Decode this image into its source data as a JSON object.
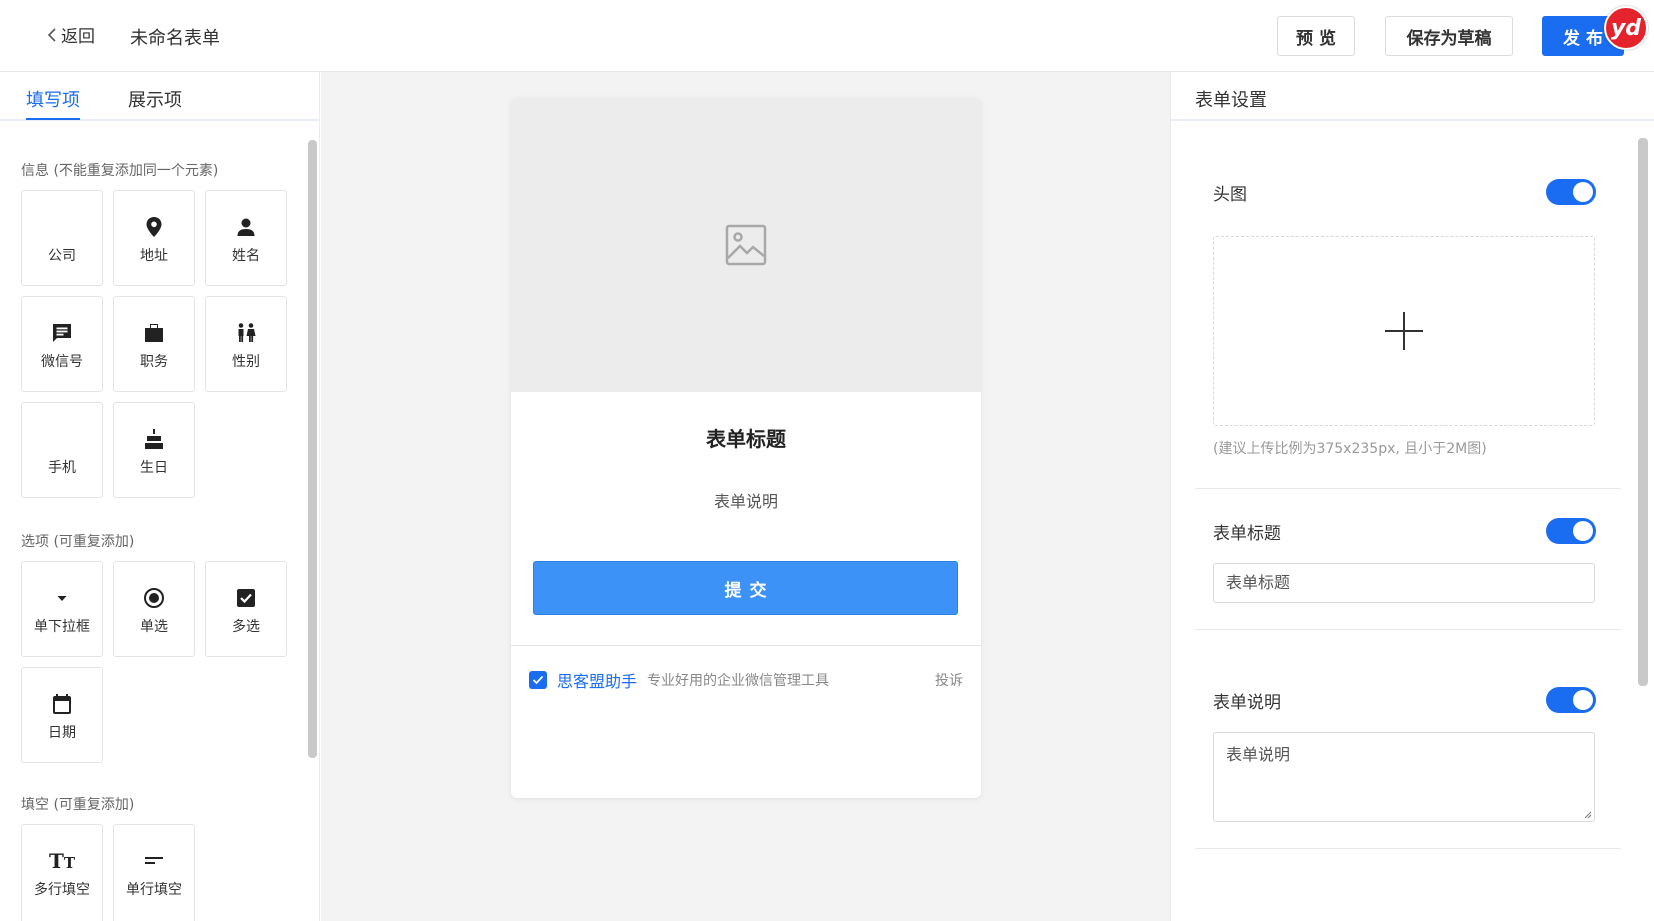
{
  "topbar": {
    "back_label": "返回",
    "form_name": "未命名表单",
    "preview_label": "预览",
    "draft_label": "保存为草稿",
    "publish_label": "发布",
    "badge_label": "yd"
  },
  "left": {
    "tabs": [
      {
        "label": "填写项",
        "active": true
      },
      {
        "label": "展示项",
        "active": false
      }
    ],
    "sections": [
      {
        "title": "信息 (不能重复添加同一个元素)",
        "items": [
          {
            "label": "公司",
            "icon": "company-icon"
          },
          {
            "label": "地址",
            "icon": "location-pin-icon"
          },
          {
            "label": "姓名",
            "icon": "person-icon"
          },
          {
            "label": "微信号",
            "icon": "chat-icon"
          },
          {
            "label": "职务",
            "icon": "briefcase-icon"
          },
          {
            "label": "性别",
            "icon": "gender-icon"
          },
          {
            "label": "手机",
            "icon": "phone-icon"
          },
          {
            "label": "生日",
            "icon": "cake-icon"
          }
        ]
      },
      {
        "title": "选项 (可重复添加)",
        "items": [
          {
            "label": "单下拉框",
            "icon": "dropdown-icon"
          },
          {
            "label": "单选",
            "icon": "radio-icon"
          },
          {
            "label": "多选",
            "icon": "checkbox-icon"
          },
          {
            "label": "日期",
            "icon": "calendar-icon"
          }
        ]
      },
      {
        "title": "填空 (可重复添加)",
        "items": [
          {
            "label": "多行填空",
            "icon": "text-size-icon"
          },
          {
            "label": "单行填空",
            "icon": "single-line-icon"
          }
        ]
      }
    ]
  },
  "preview": {
    "title": "表单标题",
    "description": "表单说明",
    "submit_label": "提交",
    "brand": "思客盟助手",
    "slogan": "专业好用的企业微信管理工具",
    "report_label": "投诉"
  },
  "settings": {
    "heading": "表单设置",
    "header_image": {
      "label": "头图",
      "enabled": true,
      "hint": "(建议上传比例为375x235px, 且小于2M图)"
    },
    "form_title": {
      "label": "表单标题",
      "enabled": true,
      "value": "表单标题"
    },
    "form_desc": {
      "label": "表单说明",
      "enabled": true,
      "value": "表单说明"
    }
  },
  "colors": {
    "accent": "#1a6cf0",
    "submit": "#3d92f7",
    "badge": "#e5232d"
  }
}
